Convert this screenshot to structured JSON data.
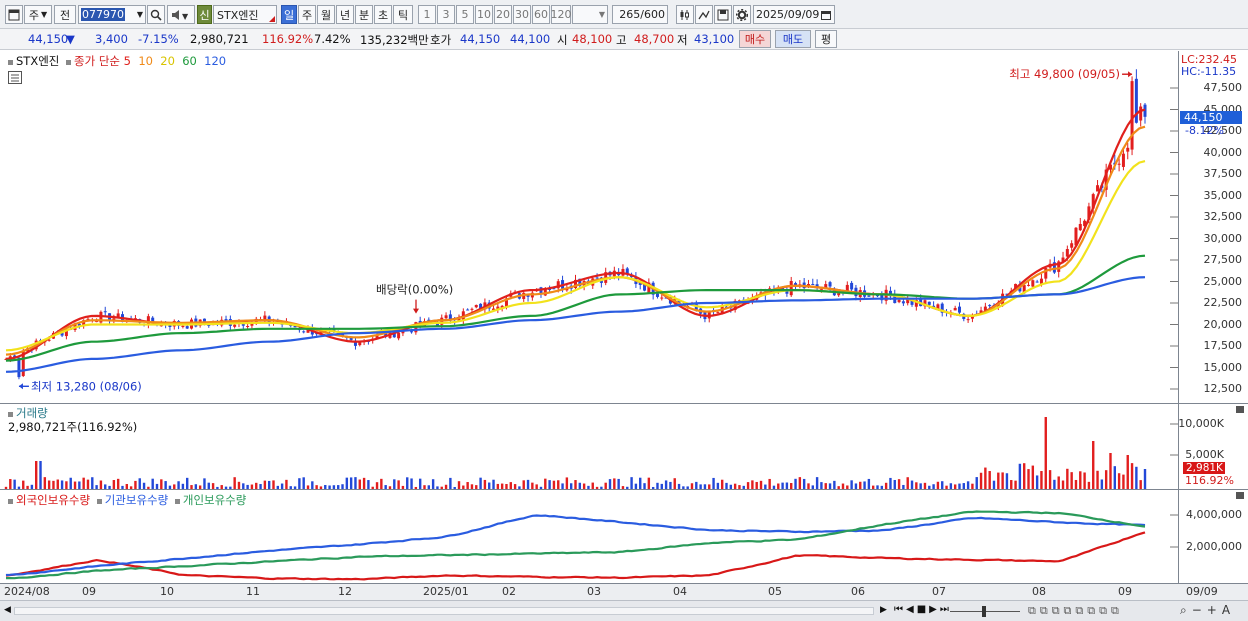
{
  "toolbar": {
    "btn_ju": "주",
    "btn_jeon": "전",
    "code": "077970",
    "btn_sin": "신",
    "stock_name": "STX엔진",
    "periods": [
      "일",
      "주",
      "월",
      "년",
      "분",
      "초",
      "틱"
    ],
    "numbers": [
      "1",
      "3",
      "5",
      "10",
      "20",
      "30",
      "60",
      "120"
    ],
    "count": "265",
    "count_total": "/600",
    "date": "2025/09/09"
  },
  "quote": {
    "price": "44,150",
    "arrow": "▼",
    "change": "3,400",
    "change_pct": "-7.15%",
    "volume": "2,980,721",
    "volume_ratio": "116.92%",
    "turnover": "7.42%",
    "amount": "135,232백만",
    "hoga_label": "호가",
    "hoga_ask": "44,150",
    "hoga_bid": "44,100",
    "open_label": "시",
    "open": "48,100",
    "high_label": "고",
    "high": "48,700",
    "low_label": "저",
    "low": "43,100",
    "buy_label": "매수",
    "sell_label": "매도",
    "eval_label": "평"
  },
  "price_pane": {
    "stock_label": "STX엔진",
    "legend_prefix": "종가 단순",
    "ma_periods": [
      "5",
      "10",
      "20",
      "60",
      "120"
    ],
    "ma_colors": [
      "#e0201c",
      "#f08a18",
      "#f2e21c",
      "#1e9a3c",
      "#2a5ce0"
    ],
    "high_note": "최고 49,800 (09/05)",
    "low_note": "최저 13,280 (08/06)",
    "dividend_note": "배당락(0.00%)",
    "lc_label": "LC:232.45",
    "hc_label": "HC:-11.35",
    "current_price": "44,150",
    "current_pct": "-8.12%",
    "yticks": [
      "47,500",
      "45,000",
      "42,500",
      "40,000",
      "37,500",
      "35,000",
      "32,500",
      "30,000",
      "27,500",
      "25,000",
      "22,500",
      "20,000",
      "17,500",
      "15,000",
      "12,500"
    ]
  },
  "volume_pane": {
    "title": "거래량",
    "info": "2,980,721주(116.92%)",
    "yticks": [
      "10,000K",
      "5,000K"
    ],
    "current": "2,981K",
    "current_pct": "116.92%"
  },
  "holding_pane": {
    "legend": [
      "외국인보유수량",
      "기관보유수량",
      "개인보유수량"
    ],
    "colors": [
      "#d81818",
      "#2a5ce0",
      "#2a9a5a"
    ],
    "yticks": [
      "4,000,000",
      "2,000,000"
    ]
  },
  "xaxis": {
    "labels": [
      "2024/08",
      "09",
      "10",
      "11",
      "12",
      "2025/01",
      "02",
      "03",
      "04",
      "05",
      "06",
      "07",
      "08",
      "09"
    ],
    "right_label": "09/09"
  },
  "chart_data": {
    "type": "line",
    "title": "",
    "price_ylim": [
      12500,
      47500
    ],
    "x": [
      "2024/08",
      "2024/09",
      "2024/10",
      "2024/11",
      "2024/12",
      "2025/01",
      "2025/02",
      "2025/03",
      "2025/04",
      "2025/05",
      "2025/06",
      "2025/07",
      "2025/08",
      "2025/09"
    ],
    "series": [
      {
        "name": "5",
        "values": [
          16000,
          21000,
          20000,
          20500,
          18000,
          20500,
          24000,
          26000,
          21000,
          24500,
          23500,
          21000,
          27000,
          45000
        ]
      },
      {
        "name": "10",
        "values": [
          16500,
          20500,
          20200,
          20500,
          18500,
          20500,
          23500,
          25500,
          21500,
          24500,
          23500,
          21000,
          26500,
          43000
        ]
      },
      {
        "name": "20",
        "values": [
          17000,
          20000,
          20000,
          20200,
          19000,
          20200,
          22500,
          25500,
          22000,
          24000,
          23500,
          21000,
          25000,
          39000
        ]
      },
      {
        "name": "60",
        "values": [
          15800,
          18000,
          19000,
          19500,
          19500,
          19800,
          21000,
          23500,
          24000,
          24000,
          23500,
          23000,
          23500,
          28000
        ]
      },
      {
        "name": "120",
        "values": [
          14500,
          16000,
          17000,
          18000,
          19000,
          19500,
          20500,
          21500,
          22500,
          22800,
          23000,
          23000,
          23500,
          25500
        ]
      }
    ],
    "low": {
      "date": "08/06",
      "value": 13280
    },
    "high": {
      "date": "09/05",
      "value": 49800
    },
    "last": 44150
  }
}
